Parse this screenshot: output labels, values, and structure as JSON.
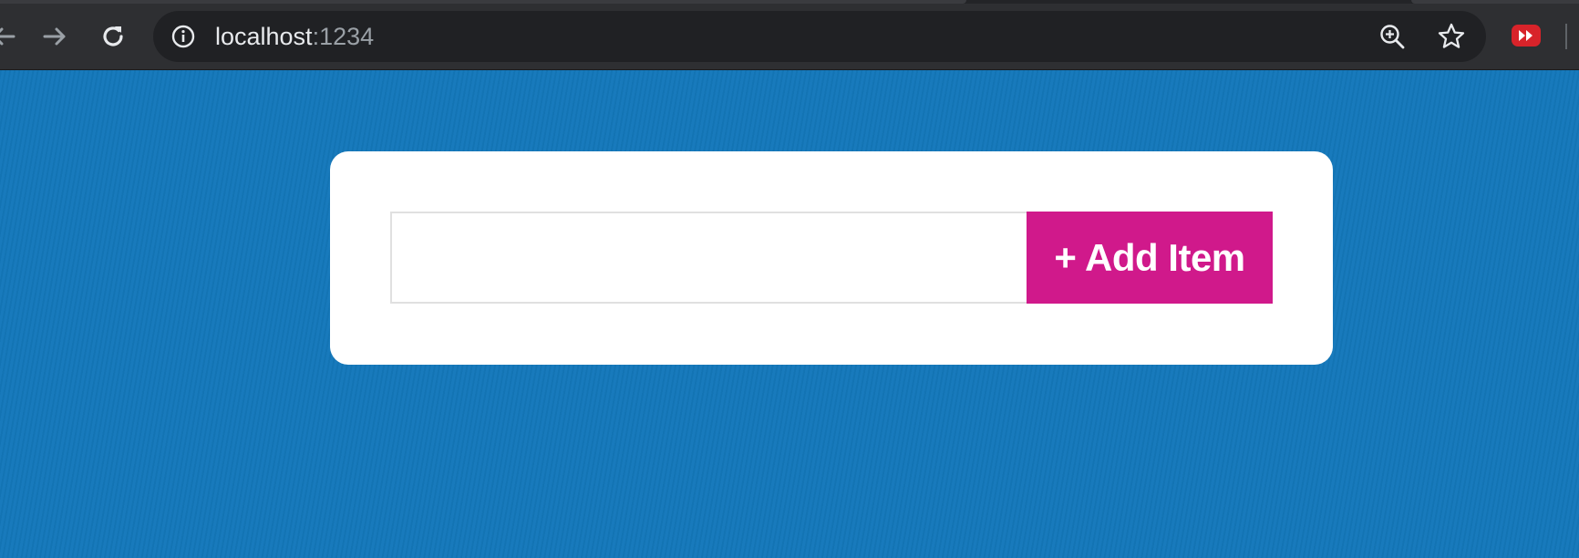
{
  "browser": {
    "url_host": "localhost",
    "url_port": ":1234",
    "icons": {
      "back": "back-arrow-icon",
      "forward": "forward-arrow-icon",
      "reload": "reload-icon",
      "site_info": "info-icon",
      "zoom": "zoom-in-icon",
      "bookmark": "star-icon",
      "extension": "fast-forward-extension-icon"
    }
  },
  "app": {
    "input": {
      "value": "",
      "placeholder": ""
    },
    "add_button_label": "+ Add Item"
  },
  "colors": {
    "page_background": "#1478bb",
    "card_background": "#ffffff",
    "button_accent": "#d0198b",
    "chrome_background": "#2e2f32",
    "omnibox_background": "#202124"
  }
}
